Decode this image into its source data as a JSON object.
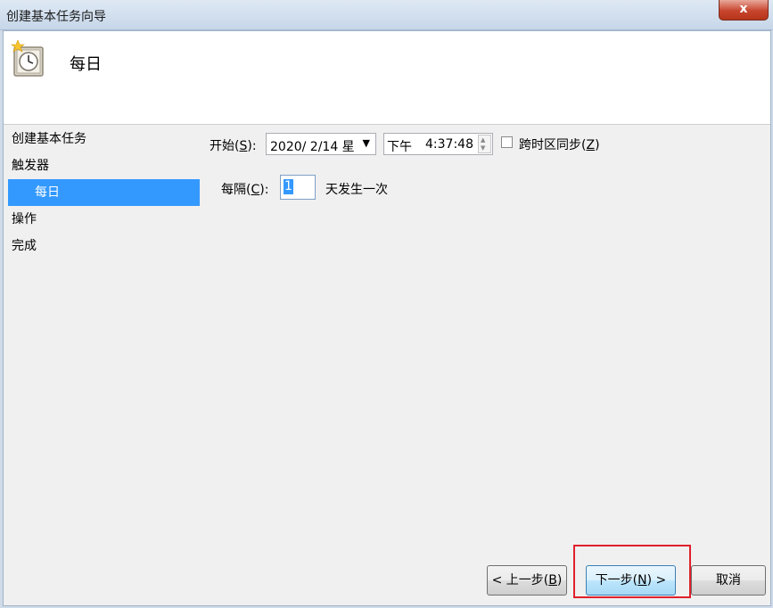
{
  "window": {
    "title": "创建基本任务向导",
    "close_label": "x"
  },
  "header": {
    "title": "每日",
    "icon": "scheduled-task-clock-icon"
  },
  "steps": [
    {
      "label": "创建基本任务"
    },
    {
      "label": "触发器"
    },
    {
      "label": "每日",
      "selected": true
    },
    {
      "label": "操作"
    },
    {
      "label": "完成"
    }
  ],
  "form": {
    "start_label_pre": "开始(",
    "start_label_key": "S",
    "start_label_post": "):",
    "date_value": "2020/  2/14 星",
    "ampm": "下午",
    "time_value": "4:37:48",
    "sync_label_pre": "跨时区同步(",
    "sync_label_key": "Z",
    "sync_label_post": ")",
    "sync_checked": false,
    "every_label_pre": "每隔(",
    "every_label_key": "C",
    "every_label_post": "):",
    "every_value": "1",
    "every_suffix": "天发生一次"
  },
  "buttons": {
    "back_pre": "< 上一步(",
    "back_key": "B",
    "back_post": ")",
    "next_pre": "下一步(",
    "next_key": "N",
    "next_post": ") >",
    "cancel": "取消"
  },
  "colors": {
    "selection": "#3399ff",
    "highlight_box": "#e0202a"
  }
}
